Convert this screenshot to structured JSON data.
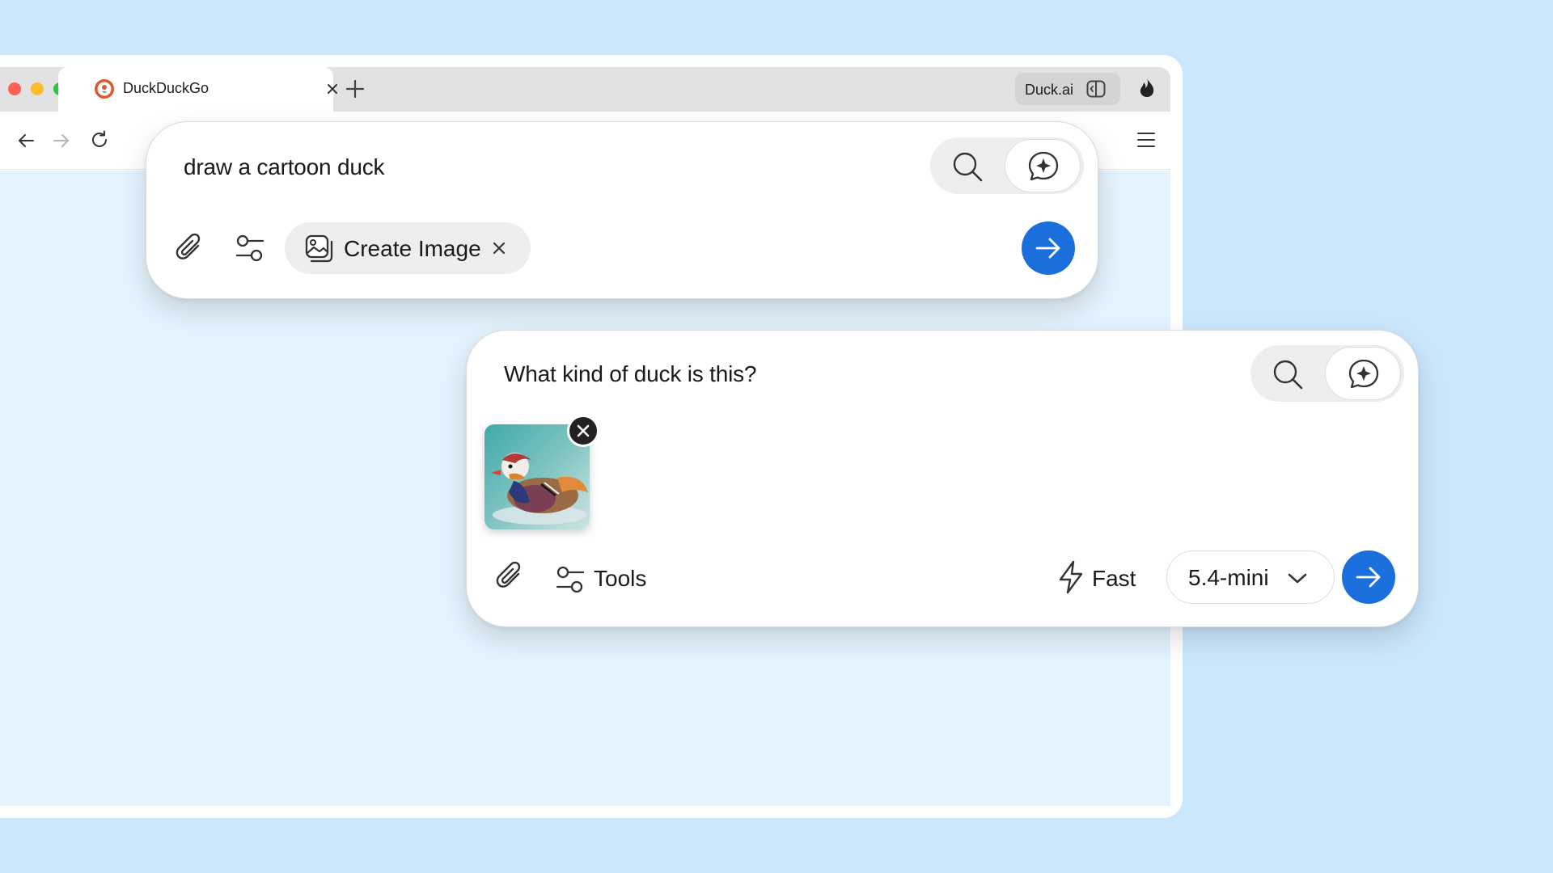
{
  "browser": {
    "tab": {
      "title": "DuckDuckGo"
    },
    "duck_ai_label": "Duck.ai"
  },
  "image_prompt_card": {
    "input_value": "draw a cartoon duck",
    "chip_label": "Create Image"
  },
  "question_card": {
    "input_value": "What kind of duck is this?",
    "tools_label": "Tools",
    "speed_label": "Fast",
    "model_selected": "5.4-mini"
  },
  "colors": {
    "page_background": "#cbe7fc",
    "send_button": "#1a6fdc",
    "browser_content": "#e4f3fd"
  },
  "icons": {
    "close_traffic": "red-circle",
    "minimize_traffic": "yellow-circle",
    "zoom_traffic": "green-circle",
    "send": "arrow-right-icon",
    "search_mode": "search-icon",
    "chat_mode": "sparkle-chat-icon",
    "attach": "paperclip-icon",
    "tools": "sliders-icon",
    "create_image": "image-stack-icon",
    "fast": "lightning-icon",
    "model_dropdown": "chevron-down-icon",
    "fire": "flame-icon",
    "menu": "hamburger-menu-icon"
  }
}
